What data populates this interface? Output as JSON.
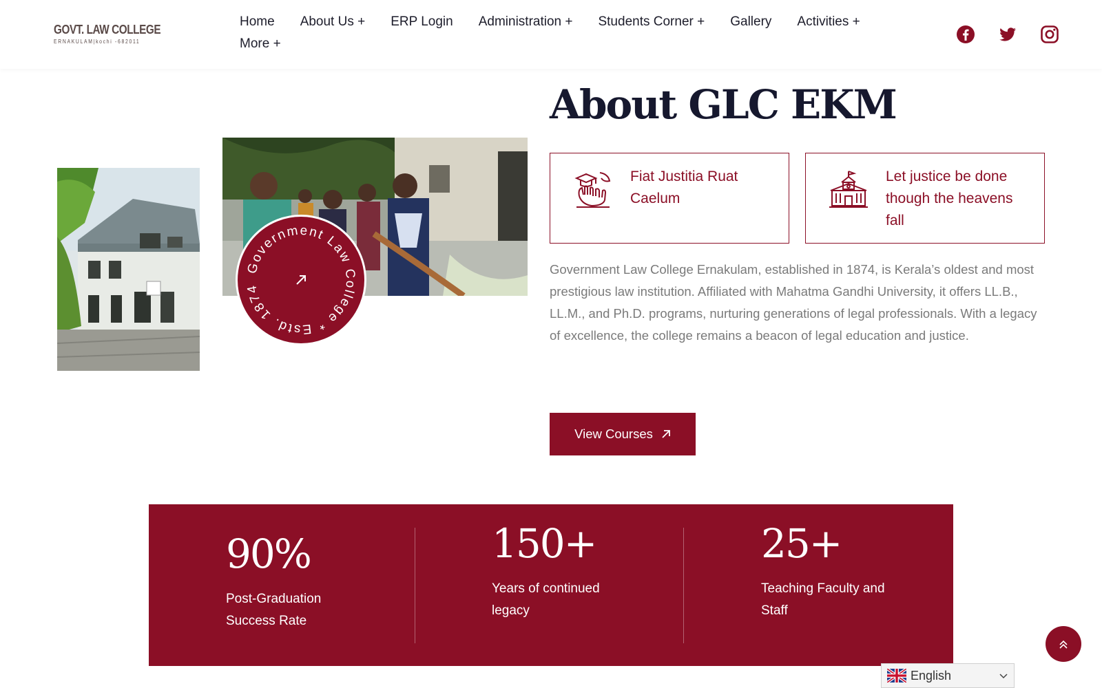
{
  "header": {
    "logo": {
      "title": "GOVT. LAW COLLEGE",
      "subtitle": "ERNAKULAM|kochi -682011"
    },
    "nav": [
      {
        "label": "Home"
      },
      {
        "label": "About Us +"
      },
      {
        "label": "ERP Login"
      },
      {
        "label": "Administration +"
      },
      {
        "label": "Students Corner +"
      },
      {
        "label": "Gallery"
      },
      {
        "label": "Activities +"
      },
      {
        "label": "More +"
      }
    ],
    "social": [
      "facebook-icon",
      "twitter-icon",
      "instagram-icon"
    ]
  },
  "badge": {
    "text": "Government Law College * Estd. 1874 *"
  },
  "about": {
    "title": "About GLC EKM",
    "mottos": [
      {
        "icon": "graduation-hands-icon",
        "text": "Fiat Justitia Ruat Caelum"
      },
      {
        "icon": "college-building-icon",
        "text": "Let justice be done though the heavens fall"
      }
    ],
    "description": "Government Law College Ernakulam, established in 1874, is Kerala’s oldest and most prestigious law institution. Affiliated with Mahatma Gandhi University, it offers LL.B., LL.M., and Ph.D. programs, nurturing generations of legal professionals. With a legacy of excellence, the college remains a beacon of legal education and justice.",
    "button_label": "View Courses"
  },
  "stats": [
    {
      "value": "90%",
      "label": "Post-Graduation Success Rate"
    },
    {
      "value": "150+",
      "label": "Years of continued legacy"
    },
    {
      "value": "25+",
      "label": "Teaching Faculty and Staff"
    }
  ],
  "language": {
    "selected": "English"
  },
  "colors": {
    "accent": "#8b0f26",
    "heading": "#16182e",
    "body_text": "#7a7a7a"
  }
}
